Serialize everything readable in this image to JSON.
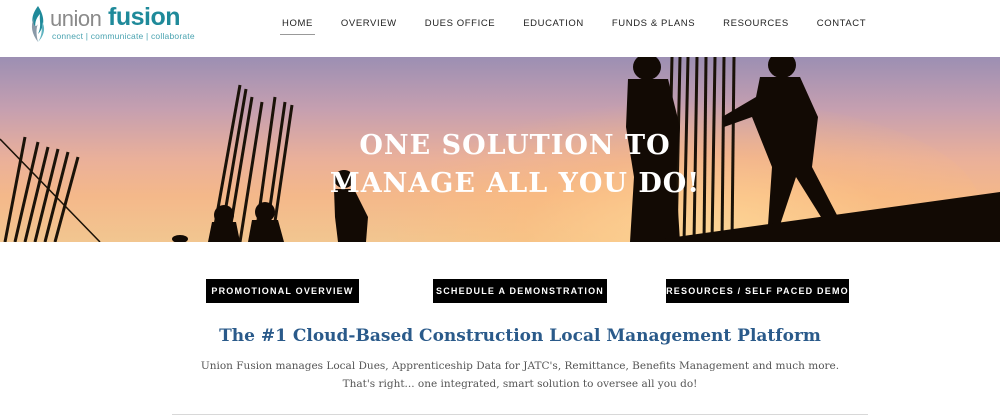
{
  "brand": {
    "name_part1": "union",
    "name_part2": "fusion",
    "tagline": "connect | communicate | collaborate",
    "colors": {
      "primary": "#1f8a9a",
      "gray": "#8a8a8a"
    }
  },
  "nav": {
    "items": [
      {
        "label": "HOME",
        "active": true
      },
      {
        "label": "OVERVIEW"
      },
      {
        "label": "DUES OFFICE"
      },
      {
        "label": "EDUCATION"
      },
      {
        "label": "FUNDS & PLANS"
      },
      {
        "label": "RESOURCES"
      },
      {
        "label": "CONTACT"
      }
    ]
  },
  "hero": {
    "line1": "ONE SOLUTION TO",
    "line2": "MANAGE ALL YOU DO!"
  },
  "buttons": {
    "promo": "PROMOTIONAL OVERVIEW",
    "demo": "SCHEDULE A DEMONSTRATION",
    "resources": "RESOURCES / SELF PACED DEMO"
  },
  "content": {
    "headline": "The #1 Cloud-Based Construction Local Management Platform",
    "desc_line1": "Union Fusion manages Local Dues, Apprenticeship Data for JATC's, Remittance, Benefits Management and much more.",
    "desc_line2": "That's right... one integrated, smart solution to oversee all you do!"
  }
}
